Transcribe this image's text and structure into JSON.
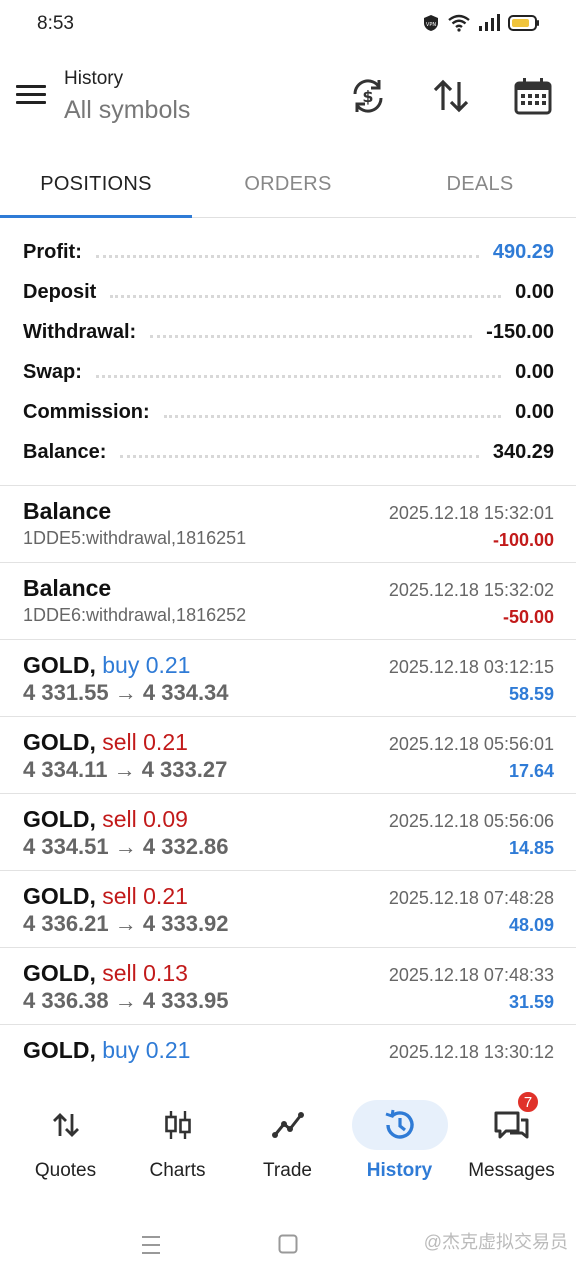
{
  "status_bar": {
    "time": "8:53",
    "icons": [
      "vpn-icon",
      "wifi-icon",
      "signal-icon",
      "battery-icon"
    ]
  },
  "header": {
    "title": "History",
    "subtitle": "All symbols",
    "icons": [
      "currency-sync-icon",
      "sort-icon",
      "calendar-icon"
    ]
  },
  "tabs": [
    {
      "label": "POSITIONS",
      "active": true
    },
    {
      "label": "ORDERS",
      "active": false
    },
    {
      "label": "DEALS",
      "active": false
    }
  ],
  "summary": [
    {
      "label": "Profit:",
      "value": "490.29",
      "color": "#2f7bd6"
    },
    {
      "label": "Deposit",
      "value": "0.00",
      "color": "#111111"
    },
    {
      "label": "Withdrawal:",
      "value": "-150.00",
      "color": "#111111"
    },
    {
      "label": "Swap:",
      "value": "0.00",
      "color": "#111111"
    },
    {
      "label": "Commission:",
      "value": "0.00",
      "color": "#111111"
    },
    {
      "label": "Balance:",
      "value": "340.29",
      "color": "#111111"
    }
  ],
  "operations": [
    {
      "title": "Balance",
      "comment": "1DDE5:withdrawal,1816251",
      "time": "2025.12.18 15:32:01",
      "amount": "-100.00"
    },
    {
      "title": "Balance",
      "comment": "1DDE6:withdrawal,1816252",
      "time": "2025.12.18 15:32:02",
      "amount": "-50.00"
    }
  ],
  "positions": [
    {
      "symbol": "GOLD,",
      "side": "buy 0.21",
      "side_color": "#2f7bd6",
      "price_open": "4 331.55",
      "arrow": "→",
      "price_close": "4 334.34",
      "time": "2025.12.18 03:12:15",
      "profit": "58.59"
    },
    {
      "symbol": "GOLD,",
      "side": "sell 0.21",
      "side_color": "#c21a1a",
      "price_open": "4 334.11",
      "arrow": "→",
      "price_close": "4 333.27",
      "time": "2025.12.18 05:56:01",
      "profit": "17.64"
    },
    {
      "symbol": "GOLD,",
      "side": "sell 0.09",
      "side_color": "#c21a1a",
      "price_open": "4 334.51",
      "arrow": "→",
      "price_close": "4 332.86",
      "time": "2025.12.18 05:56:06",
      "profit": "14.85"
    },
    {
      "symbol": "GOLD,",
      "side": "sell 0.21",
      "side_color": "#c21a1a",
      "price_open": "4 336.21",
      "arrow": "→",
      "price_close": "4 333.92",
      "time": "2025.12.18 07:48:28",
      "profit": "48.09"
    },
    {
      "symbol": "GOLD,",
      "side": "sell 0.13",
      "side_color": "#c21a1a",
      "price_open": "4 336.38",
      "arrow": "→",
      "price_close": "4 333.95",
      "time": "2025.12.18 07:48:33",
      "profit": "31.59"
    },
    {
      "symbol": "GOLD,",
      "side": "buy 0.21",
      "side_color": "#2f7bd6",
      "price_open": "",
      "arrow": "",
      "price_close": "",
      "time": "2025.12.18 13:30:12",
      "profit": ""
    }
  ],
  "bottom_nav": [
    {
      "label": "Quotes",
      "icon": "quotes-arrows-icon",
      "active": false
    },
    {
      "label": "Charts",
      "icon": "candlestick-icon",
      "active": false
    },
    {
      "label": "Trade",
      "icon": "trade-line-icon",
      "active": false
    },
    {
      "label": "History",
      "icon": "history-clock-icon",
      "active": true
    },
    {
      "label": "Messages",
      "icon": "chat-icon",
      "active": false,
      "badge": "7"
    }
  ],
  "system_nav": {
    "watermark": "@杰克虚拟交易员"
  },
  "colors": {
    "accent": "#2f7bd6",
    "loss": "#c21a1a"
  }
}
